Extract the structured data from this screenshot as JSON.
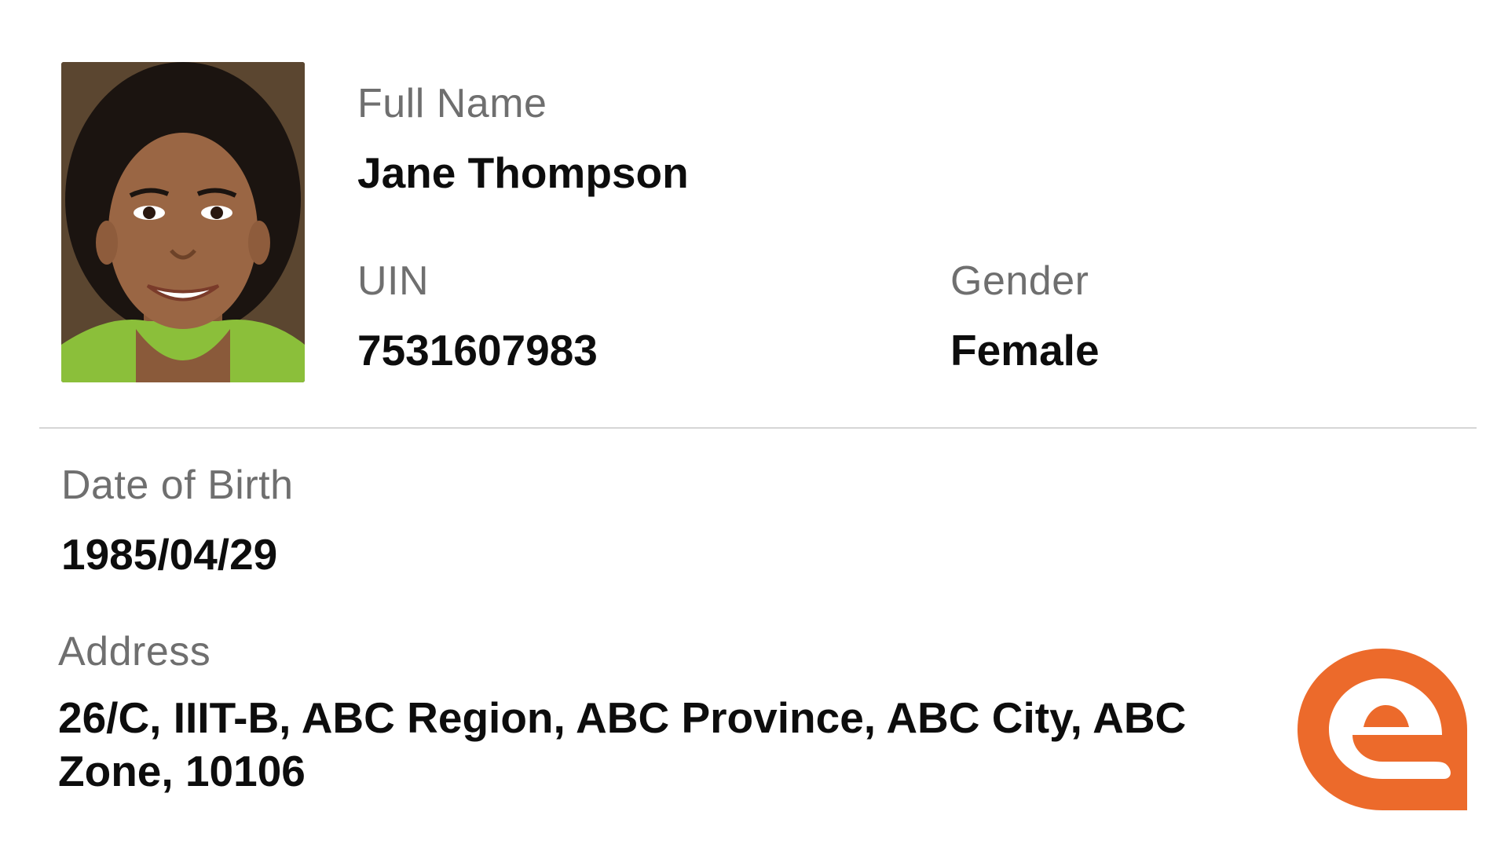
{
  "person": {
    "full_name_label": "Full Name",
    "full_name": "Jane Thompson",
    "uin_label": "UIN",
    "uin": "7531607983",
    "gender_label": "Gender",
    "gender": "Female",
    "dob_label": "Date of Birth",
    "dob": "1985/04/29",
    "address_label": "Address",
    "address": "26/C, IIIT-B, ABC Region, ABC Province, ABC City, ABC Zone, 10106"
  },
  "colors": {
    "label": "#6f6f6f",
    "value": "#0d0d0d",
    "divider": "#d6d6d6",
    "logo": "#ec6a2b"
  },
  "icons": {
    "photo": "profile-photo",
    "logo": "brand-logo-icon"
  }
}
